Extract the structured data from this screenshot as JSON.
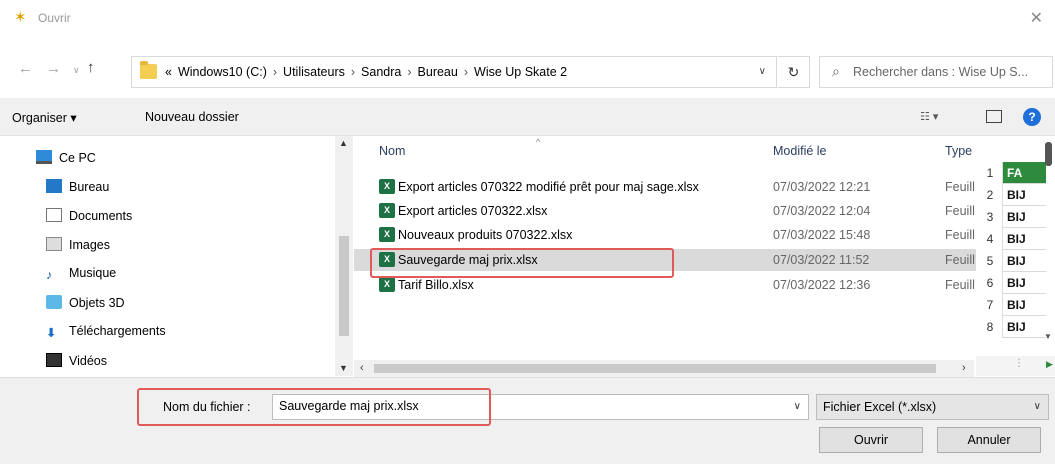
{
  "window": {
    "title": "Ouvrir",
    "close_glyph": "✕"
  },
  "nav": {
    "back_glyph": "←",
    "forward_glyph": "→",
    "recent_glyph": "∨",
    "up_glyph": "↑",
    "breadcrumb_prefix": "«",
    "breadcrumbs": [
      "Windows10 (C:)",
      "Utilisateurs",
      "Sandra",
      "Bureau",
      "Wise Up Skate 2"
    ],
    "refresh_glyph": "↻",
    "search_placeholder": "Rechercher dans : Wise Up S..."
  },
  "toolbar": {
    "organize_label": "Organiser ▾",
    "new_folder_label": "Nouveau dossier"
  },
  "sidebar": {
    "items": [
      {
        "label": "Ce PC",
        "icon": "computer-icon"
      },
      {
        "label": "Bureau",
        "icon": "desktop-icon"
      },
      {
        "label": "Documents",
        "icon": "documents-icon"
      },
      {
        "label": "Images",
        "icon": "images-icon"
      },
      {
        "label": "Musique",
        "icon": "music-icon"
      },
      {
        "label": "Objets 3D",
        "icon": "objects-3d-icon"
      },
      {
        "label": "Téléchargements",
        "icon": "downloads-icon"
      },
      {
        "label": "Vidéos",
        "icon": "videos-icon"
      }
    ]
  },
  "files": {
    "columns": {
      "name": "Nom",
      "modified": "Modifié le",
      "type": "Type"
    },
    "rows": [
      {
        "name": "Export articles 070322 modifié prêt pour maj sage.xlsx",
        "modified": "07/03/2022 12:21",
        "type": "Feuill"
      },
      {
        "name": "Export articles 070322.xlsx",
        "modified": "07/03/2022 12:04",
        "type": "Feuill"
      },
      {
        "name": "Nouveaux produits 070322.xlsx",
        "modified": "07/03/2022 15:48",
        "type": "Feuill"
      },
      {
        "name": "Sauvegarde maj prix.xlsx",
        "modified": "07/03/2022 11:52",
        "type": "Feuill",
        "selected": true
      },
      {
        "name": "Tarif Billo.xlsx",
        "modified": "07/03/2022 12:36",
        "type": "Feuill"
      }
    ],
    "file_icon_label": "X"
  },
  "preview": {
    "row_numbers": [
      "1",
      "2",
      "3",
      "4",
      "5",
      "6",
      "7",
      "8"
    ],
    "cells": [
      "FA",
      "BIJ",
      "BIJ",
      "BIJ",
      "BIJ",
      "BIJ",
      "BIJ",
      "BIJ"
    ],
    "header_color": "#2e8b3e"
  },
  "footer": {
    "filename_label": "Nom du fichier :",
    "filename_value": "Sauvegarde maj prix.xlsx",
    "filetype_value": "Fichier Excel (*.xlsx)",
    "open_label": "Ouvrir",
    "cancel_label": "Annuler"
  },
  "colors": {
    "highlight_box": "#e05a5a",
    "selected_row": "#dadada",
    "excel_green": "#1d7145"
  }
}
